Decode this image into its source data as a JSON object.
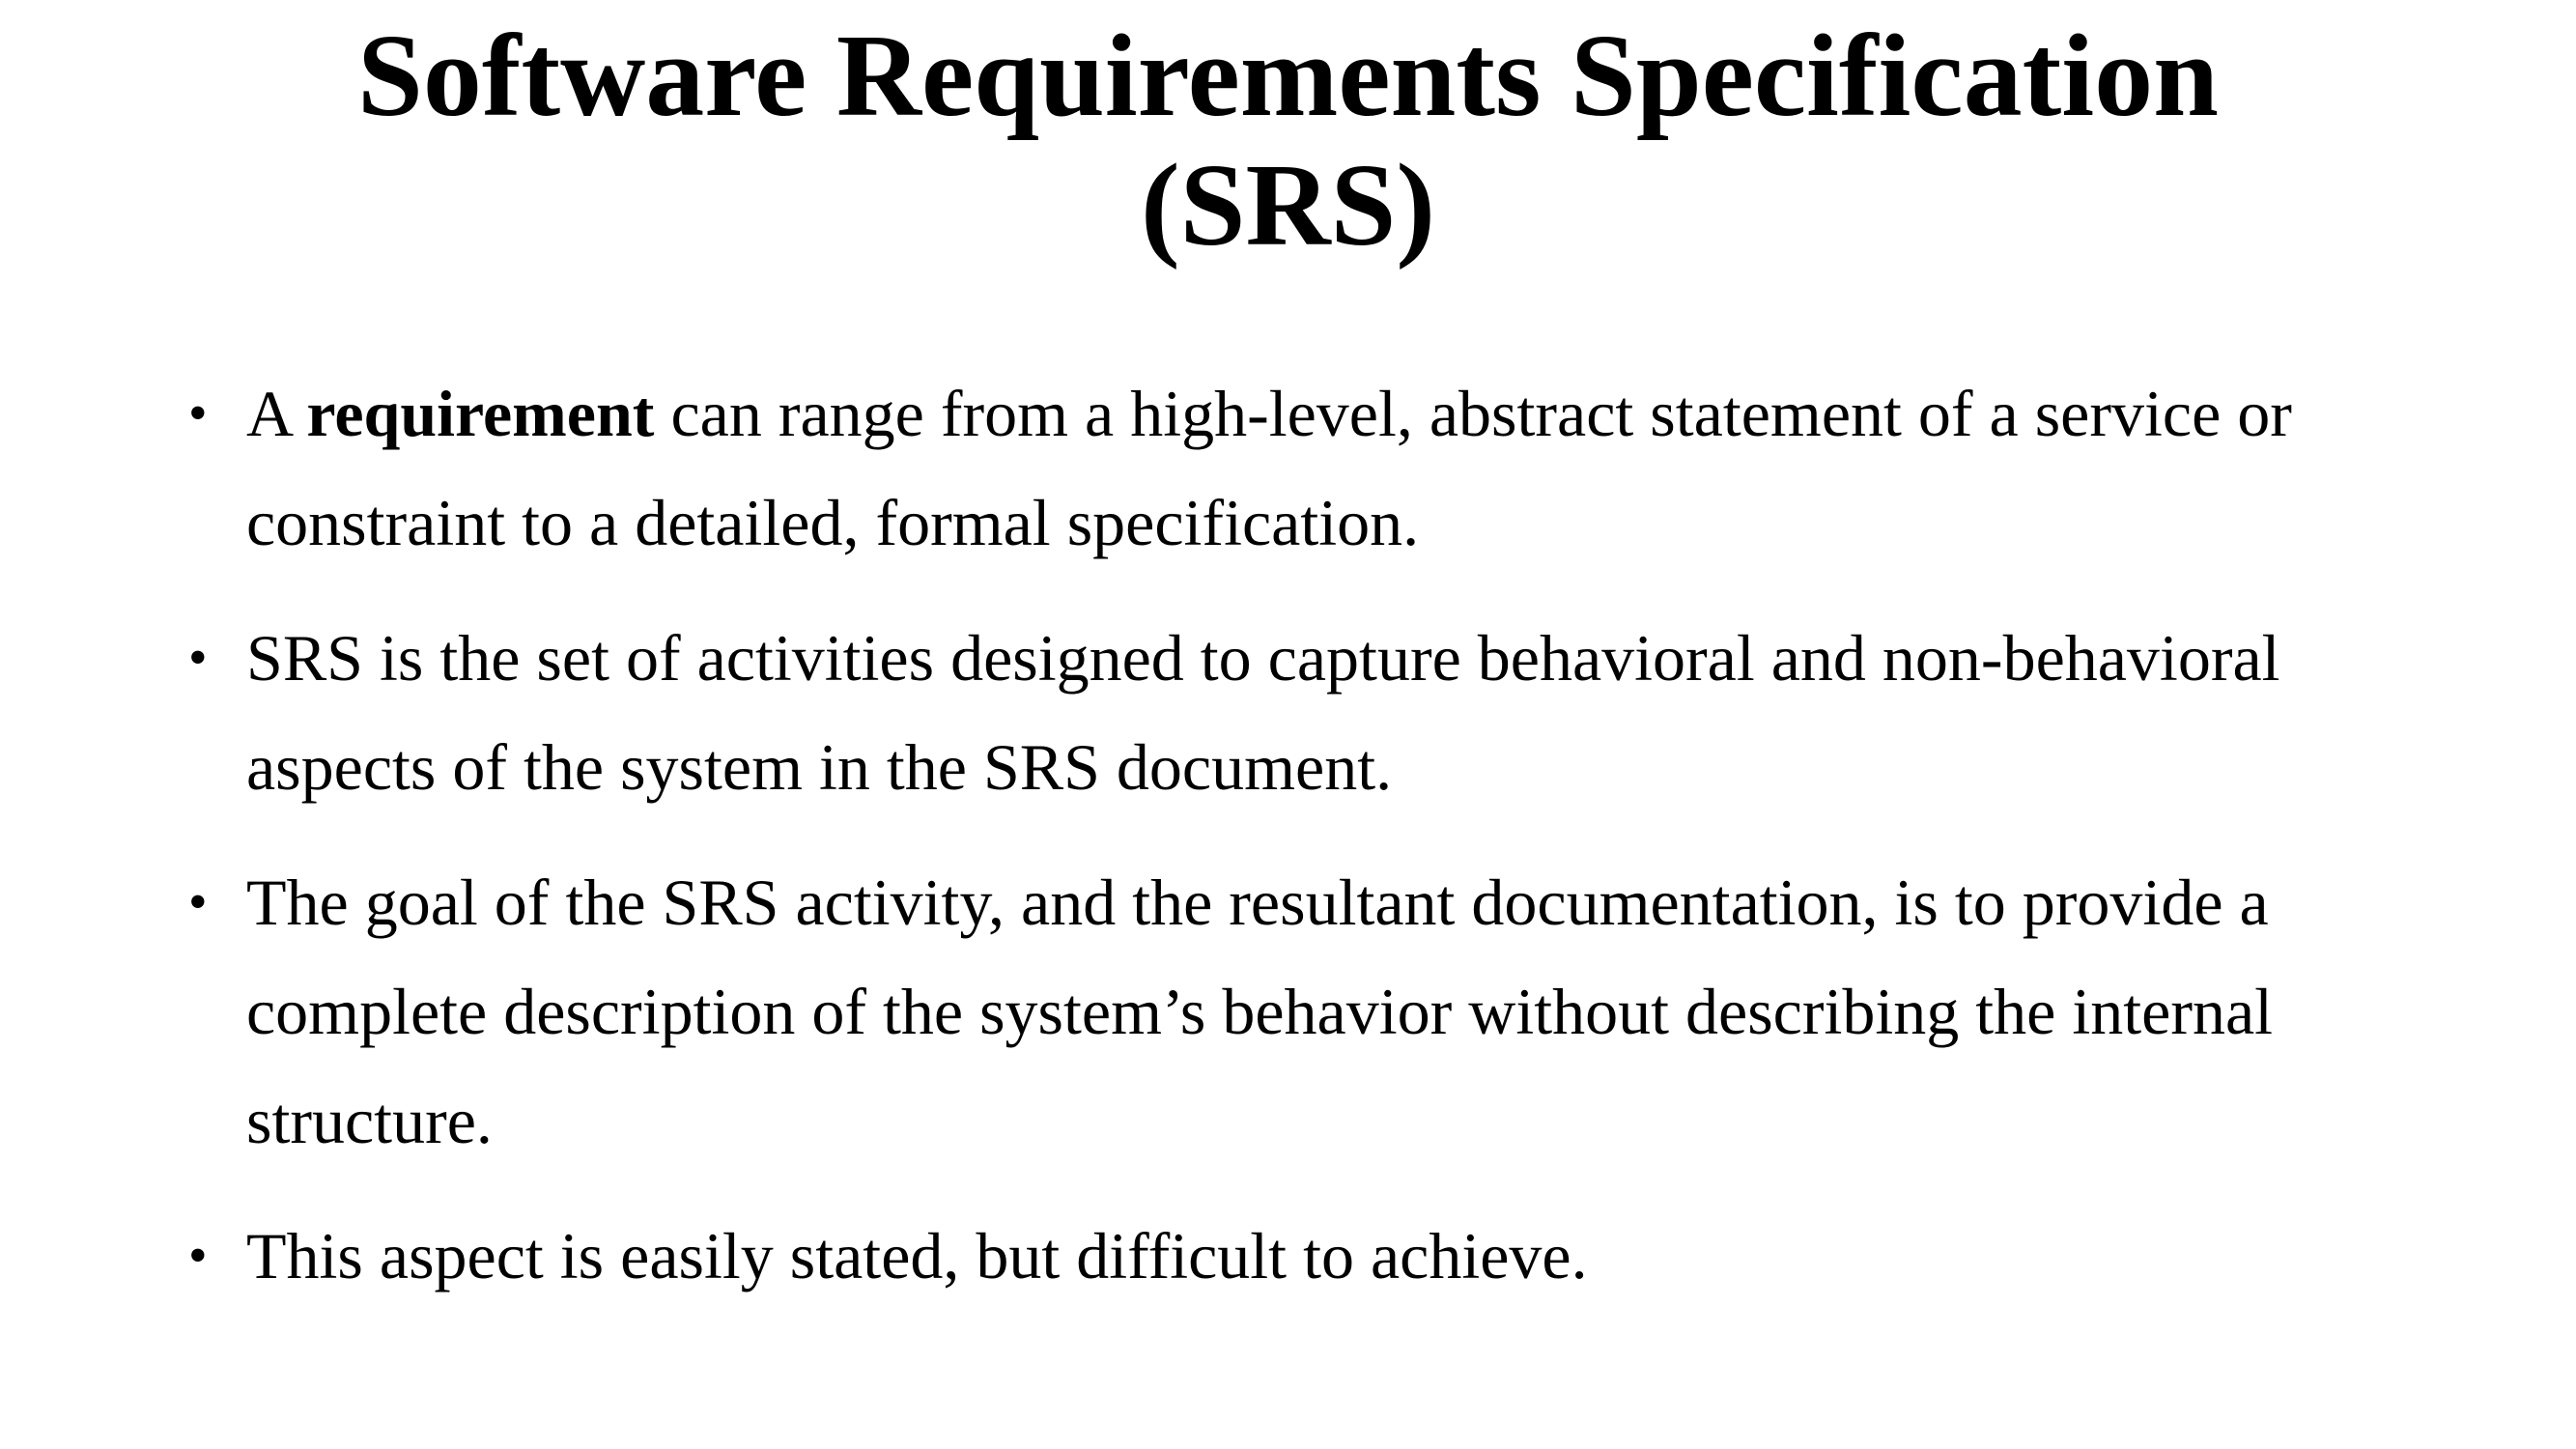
{
  "title": {
    "line1": "Software Requirements Specification",
    "line2": "(SRS)"
  },
  "bullets": [
    {
      "prefix": "A ",
      "bold": "requirement",
      "suffix": " can range from a high-level, abstract statement of a service or constraint to a detailed, formal specification."
    },
    {
      "text": "SRS is the set of activities designed to capture behavioral and non-behavioral aspects of the system in the SRS document."
    },
    {
      "text": "The goal of the SRS activity, and the resultant documentation, is to provide a complete description of the system’s behavior without describing the internal structure."
    },
    {
      "text": "This aspect is easily stated, but difficult to achieve."
    }
  ],
  "bullet_glyph": "•"
}
